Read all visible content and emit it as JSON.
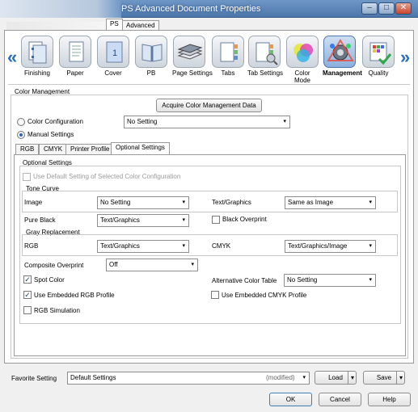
{
  "window": {
    "title": "PS Advanced Document Properties",
    "minimize": "–",
    "maximize": "□",
    "close": "✕"
  },
  "top_tabs": [
    "PS",
    "Advanced"
  ],
  "ribbon": {
    "left_arrow": "«",
    "right_arrow": "»",
    "items": [
      {
        "label": "Finishing",
        "icon": "finishing-icon"
      },
      {
        "label": "Paper",
        "icon": "paper-icon"
      },
      {
        "label": "Cover",
        "icon": "cover-icon"
      },
      {
        "label": "PB",
        "icon": "perfect-binding-icon"
      },
      {
        "label": "Page Settings",
        "icon": "page-settings-icon"
      },
      {
        "label": "Tabs",
        "icon": "tabs-icon"
      },
      {
        "label": "Tab Settings",
        "icon": "tab-settings-icon"
      },
      {
        "label": "Color\nMode",
        "icon": "color-mode-icon"
      },
      {
        "label": "Management",
        "icon": "management-icon"
      },
      {
        "label": "Quality",
        "icon": "quality-icon"
      }
    ],
    "cover_glyph": "1",
    "selected": "Management"
  },
  "color_management": {
    "section_label": "Color Management",
    "acquire_button": "Acquire Color Management Data",
    "color_config_label": "Color Configuration",
    "color_config_value": "No Setting",
    "manual_label": "Manual Settings"
  },
  "sub_tabs": [
    "RGB",
    "CMYK",
    "Printer Profile",
    "Optional Settings"
  ],
  "optional": {
    "group_label": "Optional Settings",
    "use_default_label": "Use Default Setting of Selected Color Configuration",
    "tone_curve": {
      "label": "Tone Curve",
      "image_label": "Image",
      "image_value": "No Setting",
      "text_graphics_label": "Text/Graphics",
      "text_graphics_value": "Same as Image"
    },
    "pure_black_label": "Pure Black",
    "pure_black_value": "Text/Graphics",
    "black_overprint_label": "Black Overprint",
    "gray_replacement": {
      "label": "Gray Replacement",
      "rgb_label": "RGB",
      "rgb_value": "Text/Graphics",
      "cmyk_label": "CMYK",
      "cmyk_value": "Text/Graphics/Image"
    },
    "composite_overprint_label": "Composite Overprint",
    "composite_overprint_value": "Off",
    "spot_color_label": "Spot Color",
    "alt_color_table_label": "Alternative Color Table",
    "alt_color_table_value": "No Setting",
    "embedded_rgb_label": "Use Embedded RGB Profile",
    "embedded_cmyk_label": "Use Embedded CMYK Profile",
    "rgb_simulation_label": "RGB Simulation",
    "check_glyph": "✓"
  },
  "footer": {
    "favorite_label": "Favorite Setting",
    "favorite_value": "Default Settings",
    "modified": "(modified)",
    "load": "Load",
    "save": "Save",
    "ok": "OK",
    "cancel": "Cancel",
    "help": "Help",
    "dropdown_glyph": "▾"
  }
}
